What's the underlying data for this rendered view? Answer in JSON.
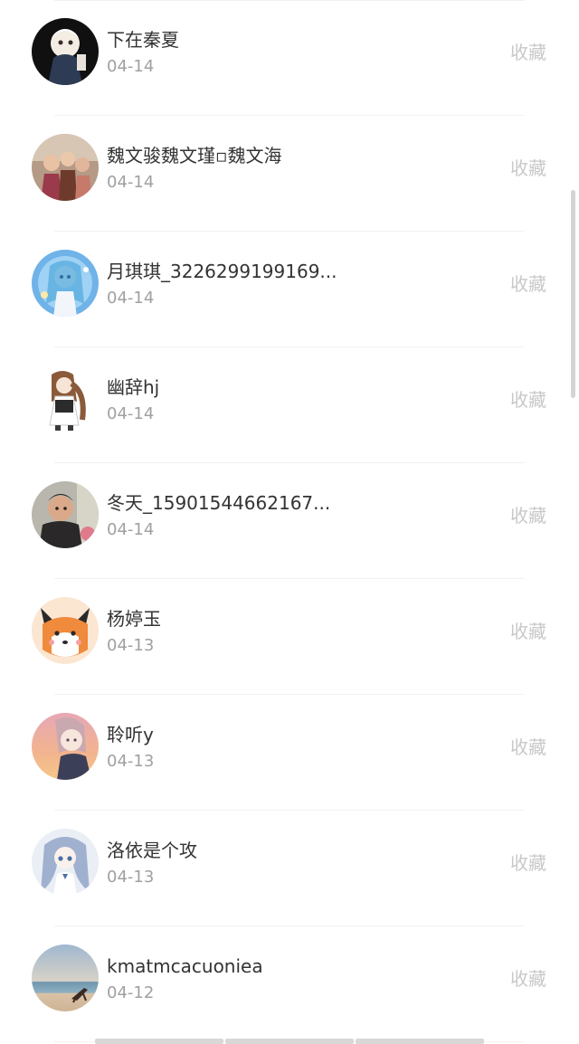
{
  "fav_label": "收藏",
  "items": [
    {
      "name": "下在秦夏",
      "date": "04-14",
      "avatar": "avatar-anime-dark"
    },
    {
      "name": "魏文骏魏文瑾▫魏文海",
      "date": "04-14",
      "avatar": "avatar-family-photo"
    },
    {
      "name": "月琪琪_3226299199169...",
      "date": "04-14",
      "avatar": "avatar-anime-blue"
    },
    {
      "name": "幽辞hj",
      "date": "04-14",
      "avatar": "avatar-anime-maid"
    },
    {
      "name": "冬天_15901544662167...",
      "date": "04-14",
      "avatar": "avatar-child-photo"
    },
    {
      "name": "杨婷玉",
      "date": "04-13",
      "avatar": "avatar-cartoon-fox"
    },
    {
      "name": "聆听y",
      "date": "04-13",
      "avatar": "avatar-anime-sunset"
    },
    {
      "name": "洛依是个攻",
      "date": "04-13",
      "avatar": "avatar-anime-silver"
    },
    {
      "name": "kmatmcacuoniea",
      "date": "04-12",
      "avatar": "avatar-beach-photo"
    }
  ]
}
